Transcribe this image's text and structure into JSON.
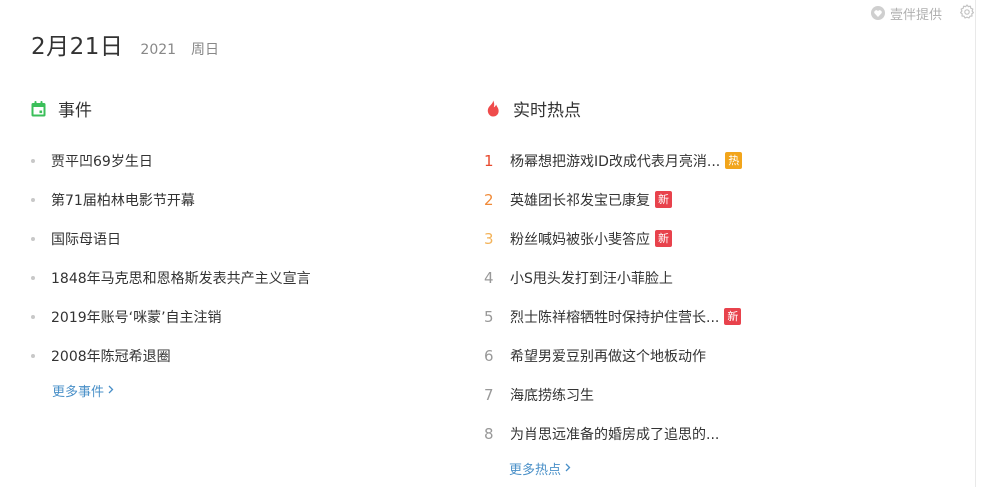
{
  "provider": {
    "label": "壹伴提供"
  },
  "date": {
    "main": "2月21日",
    "year": "2021",
    "weekday": "周日"
  },
  "events": {
    "title": "事件",
    "items": [
      "贾平凹69岁生日",
      "第71届柏林电影节开幕",
      "国际母语日",
      "1848年马克思和恩格斯发表共产主义宣言",
      "2019年账号‘咪蒙’自主注销",
      "2008年陈冠希退圈"
    ],
    "more": "更多事件"
  },
  "hot": {
    "title": "实时热点",
    "items": [
      {
        "rank": "1",
        "title": "杨幂想把游戏ID改成代表月亮消...",
        "badge": "热"
      },
      {
        "rank": "2",
        "title": "英雄团长祁发宝已康复",
        "badge": "新"
      },
      {
        "rank": "3",
        "title": "粉丝喊妈被张小斐答应",
        "badge": "新"
      },
      {
        "rank": "4",
        "title": "小S甩头发打到汪小菲脸上",
        "badge": ""
      },
      {
        "rank": "5",
        "title": "烈士陈祥榕牺牲时保持护住营长...",
        "badge": "新"
      },
      {
        "rank": "6",
        "title": "希望男爱豆别再做这个地板动作",
        "badge": ""
      },
      {
        "rank": "7",
        "title": "海底捞练习生",
        "badge": ""
      },
      {
        "rank": "8",
        "title": "为肖思远准备的婚房成了追思的...",
        "badge": ""
      }
    ],
    "more": "更多热点"
  },
  "colors": {
    "calendar_icon": "#3bbf5a",
    "fire_icon": "#ef4b4b",
    "link": "#4a90c8",
    "badge_hot": "#f2a51b",
    "badge_new": "#e8424c"
  }
}
